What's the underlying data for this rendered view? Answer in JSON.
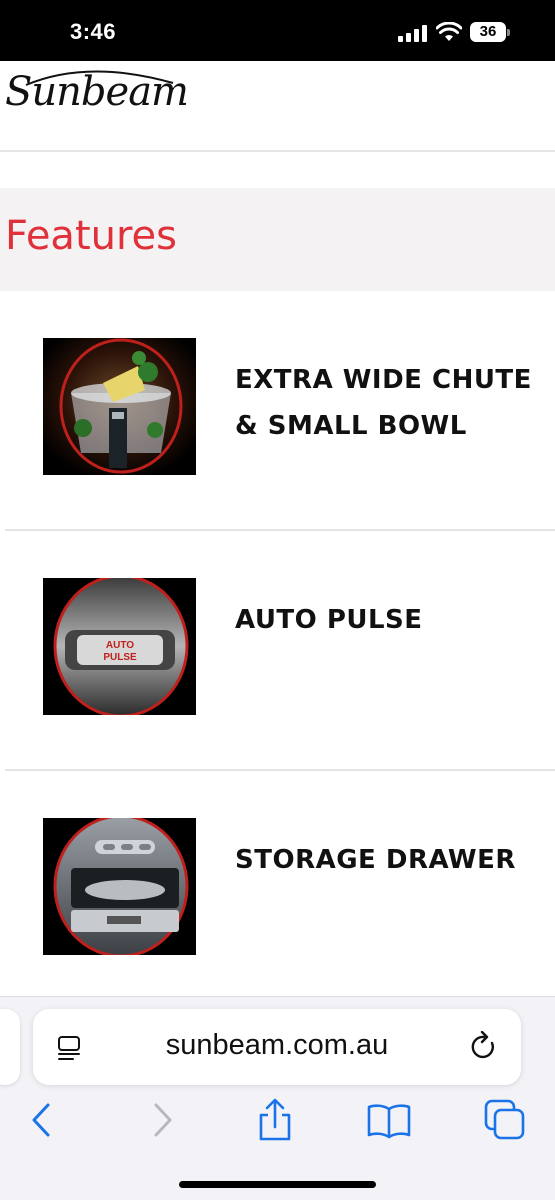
{
  "status_bar": {
    "time": "3:46",
    "battery_level": "36",
    "icons": [
      "signal-icon",
      "wifi-icon",
      "battery-icon"
    ]
  },
  "header": {
    "logo_text": "Sunbeam"
  },
  "features": {
    "title": "Features",
    "items": [
      {
        "label": "EXTRA WIDE CHUTE & SMALL BOWL",
        "image": "chute-bowl-photo"
      },
      {
        "label": "AUTO PULSE",
        "image": "auto-pulse-button-photo",
        "image_text": "AUTO PULSE"
      },
      {
        "label": "STORAGE DRAWER",
        "image": "storage-drawer-photo"
      }
    ]
  },
  "browser": {
    "url": "sunbeam.com.au",
    "toolbar": [
      "back-icon",
      "forward-icon",
      "share-icon",
      "bookmarks-icon",
      "tabs-icon"
    ]
  },
  "colors": {
    "accent_red": "#e0303a",
    "ios_blue": "#1a73e8",
    "band_gray": "#f4f2f2"
  }
}
